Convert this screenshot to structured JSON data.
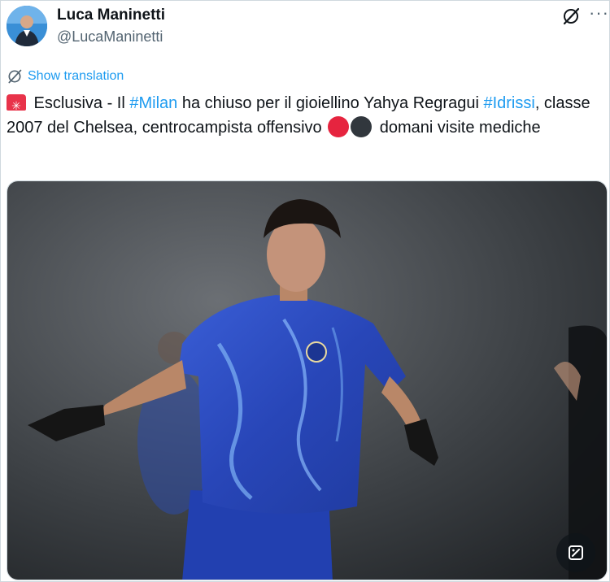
{
  "author": {
    "display_name": "Luca Maninetti",
    "handle": "@LucaManinetti"
  },
  "header_icons": [
    "grok-icon",
    "more-options-icon"
  ],
  "translation": {
    "label": "Show translation"
  },
  "tweet": {
    "emoji_lead": "siren-emoji",
    "text_1": " Esclusiva - Il ",
    "hashtag_1": "#Milan",
    "text_2": " ha chiuso per il gioiellino Yahya Regragui ",
    "hashtag_2": "#Idrissi",
    "text_3": ", classe 2007 del Chelsea, centrocampista offensivo ",
    "emoji_colors": [
      "red-circle-emoji",
      "black-circle-emoji"
    ],
    "text_4": " domani visite mediche"
  },
  "media": {
    "description": "photo",
    "action_icon": "image-edit-icon"
  },
  "colors": {
    "accent": "#1d9bf0",
    "text": "#0f1419",
    "muted": "#536471",
    "jersey": "#2f4fc9"
  }
}
